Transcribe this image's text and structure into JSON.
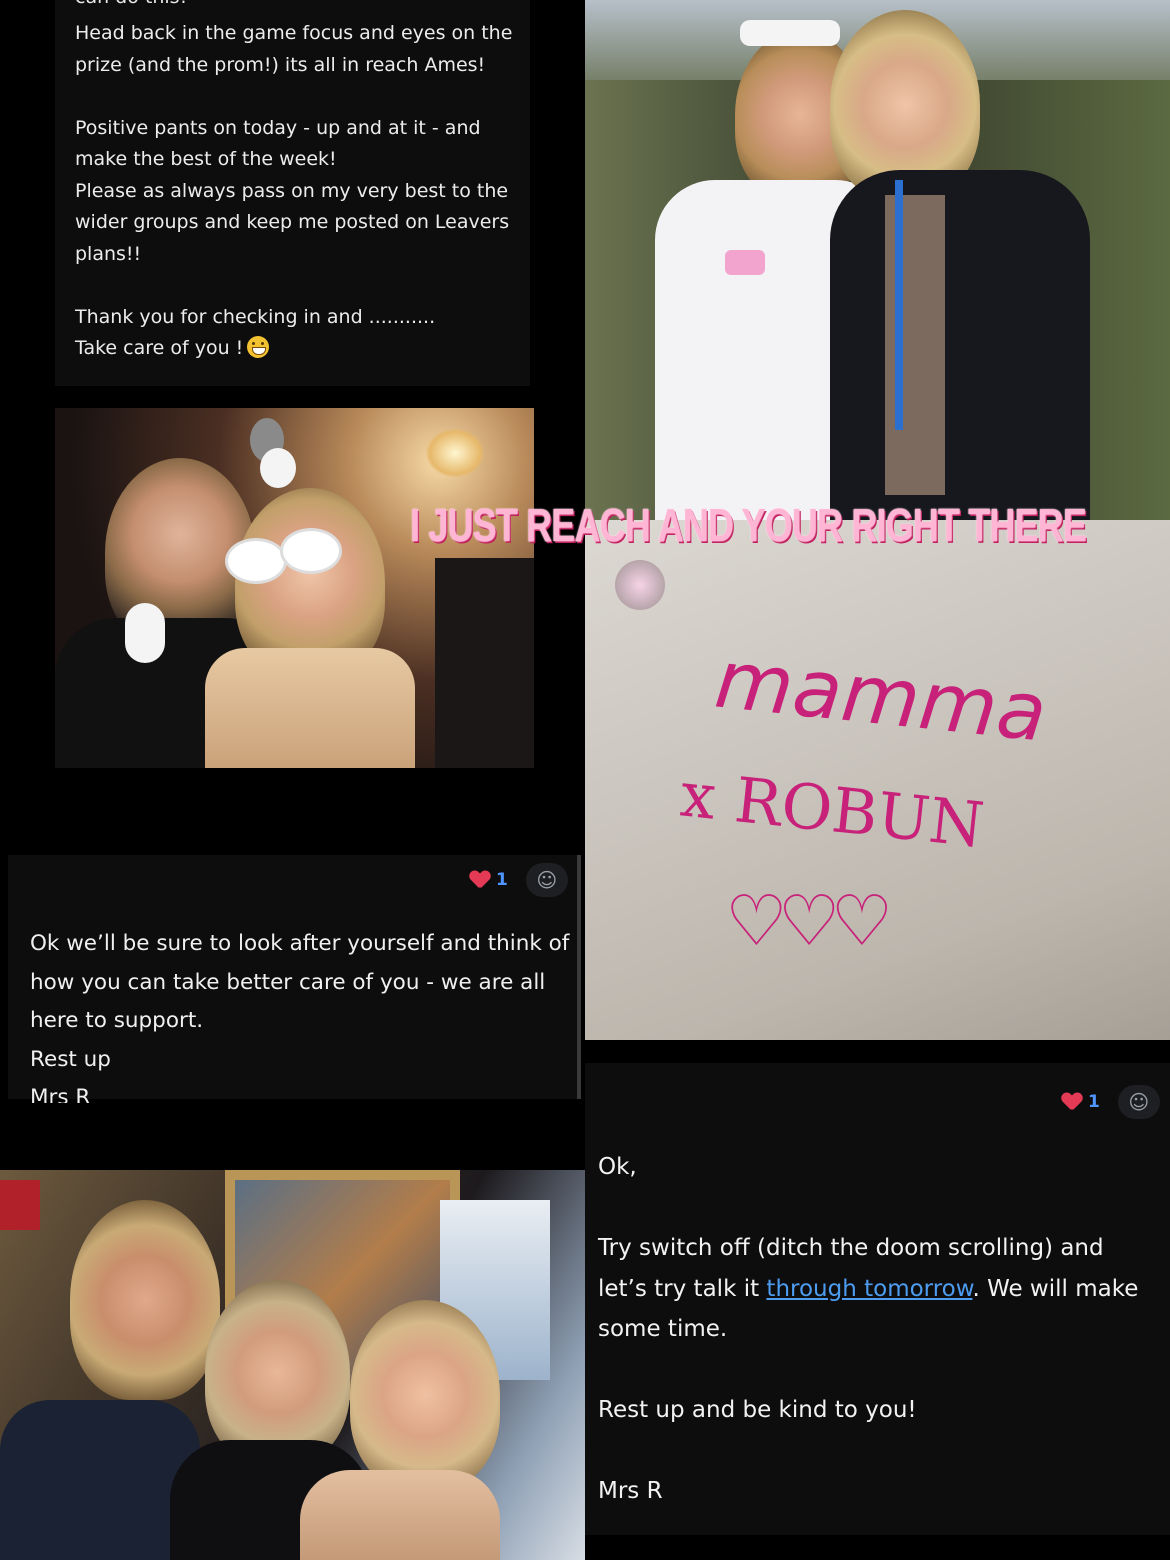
{
  "message_top": {
    "cut_line": "can do this!",
    "paragraphs": [
      "Head back in the game focus and eyes on the prize (and the prom!) its all in reach Ames!",
      "Positive pants on today - up and at it - and make the best of the week!",
      "Please as always pass on my very best to the wider groups and keep me posted on Leavers plans!!",
      "Thank you for checking in and ..........."
    ],
    "closing": "Take care of you !"
  },
  "overlay_caption": "I JUST REACH AND YOUR RIGHT THERE",
  "shirt_writing": {
    "line1": "mamma",
    "line2": "x ROBUN"
  },
  "message_middle": {
    "reaction_count": "1",
    "text": "Ok we’ll be sure to look after yourself and think of how you can take better care of you - we are all here to support.",
    "line2": "Rest up",
    "signature_cut": "Mrs R"
  },
  "message_bottom": {
    "reaction_count": "1",
    "greeting": "Ok,",
    "p1_before": "Try switch off (ditch the doom scrolling) and let’s try talk it ",
    "p1_link": "through tomorrow",
    "p1_after": ". We will make some time.",
    "p2": "Rest up and be kind to you!",
    "signature": "Mrs R"
  },
  "colors": {
    "background": "#000000",
    "card": "#0d0d0e",
    "heart": "#e53a55",
    "count": "#4f95ff",
    "link": "#4d9cf0",
    "overlay_text": "#ffb6d5",
    "marker": "#c8217a"
  },
  "icons": [
    "grinning-face-emoji",
    "heart-icon",
    "add-reaction-icon"
  ]
}
